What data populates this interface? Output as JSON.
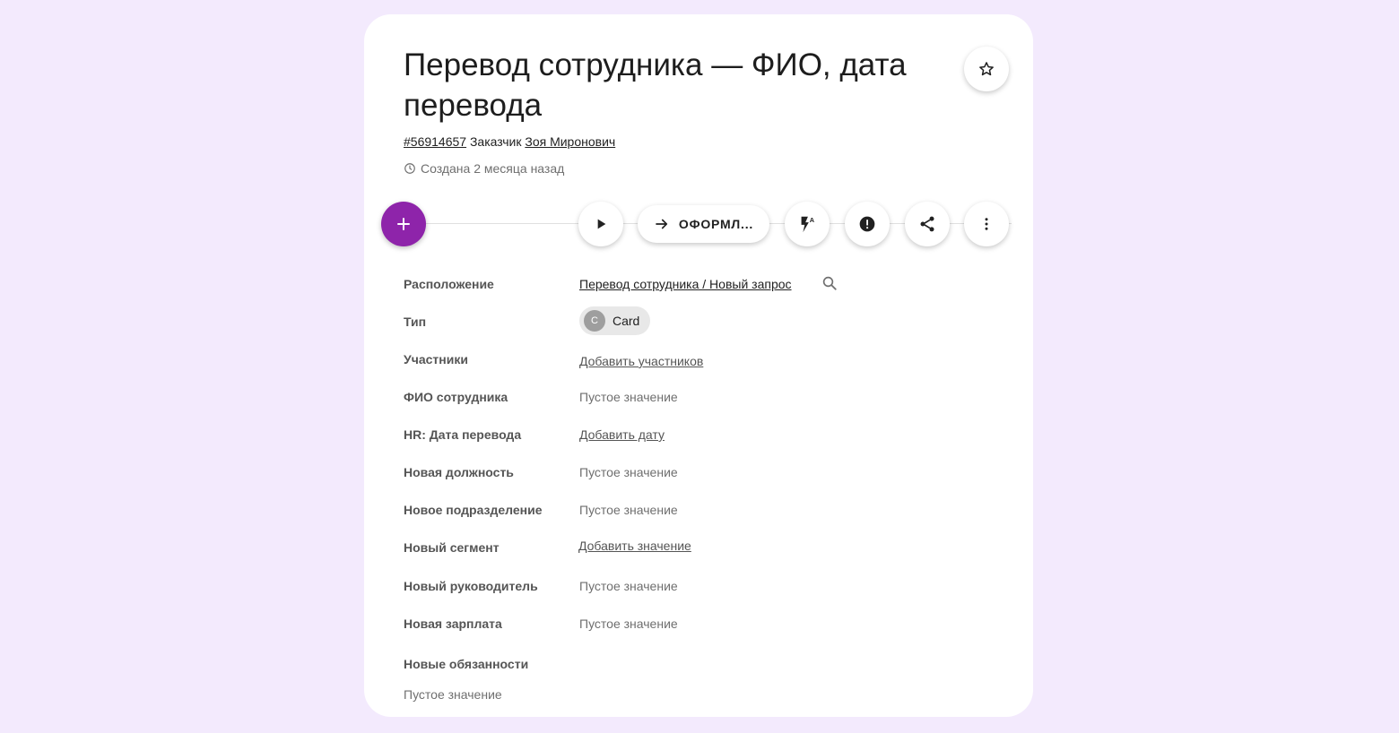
{
  "header": {
    "title": "Перевод сотрудника — ФИО, дата перевода",
    "ticket_id": "#56914657",
    "customer_label": "Заказчик",
    "customer_name": "Зоя Миронович",
    "created": "Создана 2 месяца назад"
  },
  "toolbar": {
    "pill_label": "ОФОРМЛ...",
    "icons": [
      "plus-icon",
      "play-icon",
      "arrow-right-icon",
      "flash-auto-icon",
      "alert-icon",
      "share-icon",
      "more-vert-icon",
      "star-icon"
    ]
  },
  "fields": {
    "location": {
      "label": "Расположение",
      "value": "Перевод сотрудника / Новый запрос"
    },
    "type": {
      "label": "Тип",
      "chip_initial": "C",
      "chip_text": "Card"
    },
    "participants": {
      "label": "Участники",
      "value": "Добавить участников"
    },
    "employee_name": {
      "label": "ФИО сотрудника",
      "value": "Пустое значение"
    },
    "transfer_date": {
      "label": "HR: Дата перевода",
      "value": "Добавить дату"
    },
    "new_position": {
      "label": "Новая должность",
      "value": "Пустое значение"
    },
    "new_department": {
      "label": "Новое подразделение",
      "value": "Пустое значение"
    },
    "new_segment": {
      "label": "Новый сегмент",
      "value": "Добавить значение"
    },
    "new_manager": {
      "label": "Новый руководитель",
      "value": "Пустое значение"
    },
    "new_salary": {
      "label": "Новая зарплата",
      "value": "Пустое значение"
    },
    "new_duties": {
      "label": "Новые обязанности",
      "value": "Пустое значение"
    }
  },
  "colors": {
    "background": "#f3eafd",
    "accent": "#8e24aa",
    "card": "#ffffff"
  }
}
